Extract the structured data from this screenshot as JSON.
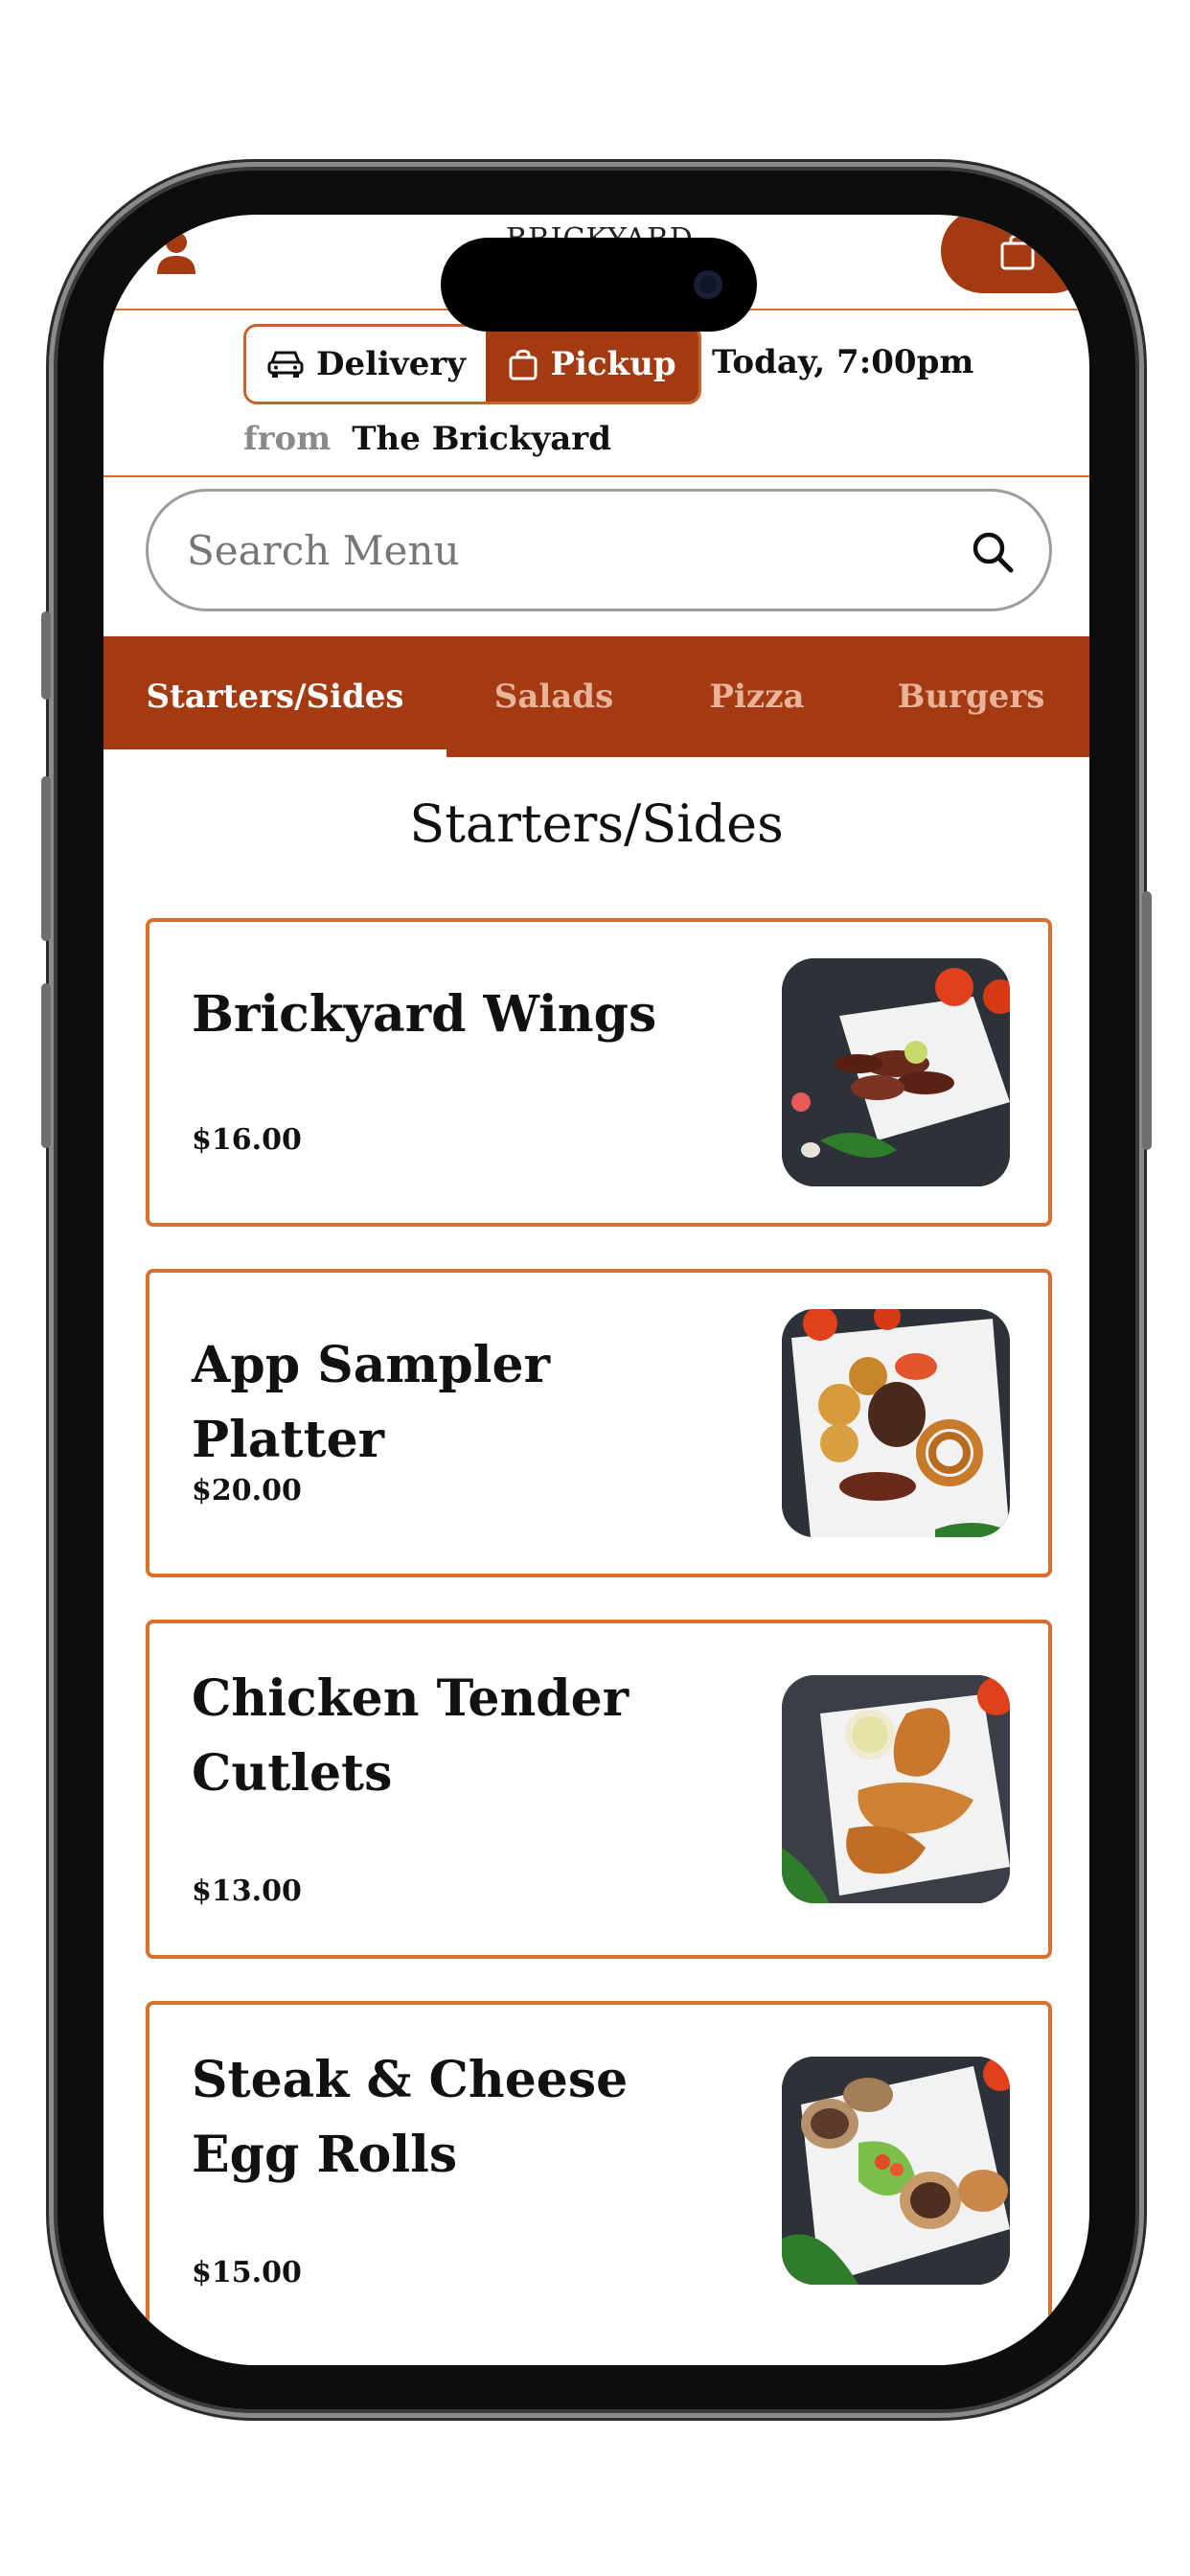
{
  "header": {
    "logo_text": "BRICKYARD",
    "icons": {
      "account": "user-icon",
      "cart": "shopping-bag-icon"
    }
  },
  "order": {
    "delivery_label": "Delivery",
    "pickup_label": "Pickup",
    "selected_mode": "Pickup",
    "time": "Today, 7:00pm",
    "from_label": "from",
    "location": "The Brickyard",
    "icons": {
      "delivery": "car-icon",
      "pickup": "shopping-bag-icon"
    }
  },
  "search": {
    "placeholder": "Search Menu",
    "value": "",
    "icon": "search-icon"
  },
  "tabs": [
    {
      "label": "Starters/Sides",
      "active": true
    },
    {
      "label": "Salads",
      "active": false
    },
    {
      "label": "Pizza",
      "active": false
    },
    {
      "label": "Burgers",
      "active": false
    }
  ],
  "section": {
    "title": "Starters/Sides"
  },
  "items": [
    {
      "name": "Brickyard Wings",
      "price": "$16.00",
      "image": "chicken-wings-photo"
    },
    {
      "name": "App Sampler Platter",
      "price": "$20.00",
      "image": "sampler-platter-photo"
    },
    {
      "name": "Chicken Tender Cutlets",
      "price": "$13.00",
      "image": "chicken-cutlets-photo"
    },
    {
      "name": "Steak & Cheese Egg Rolls",
      "price": "$15.00",
      "image": "egg-rolls-photo"
    }
  ],
  "colors": {
    "brand": "#a33a11",
    "accent_border": "#d9702f",
    "tab_inactive_text": "#e9b39a"
  }
}
